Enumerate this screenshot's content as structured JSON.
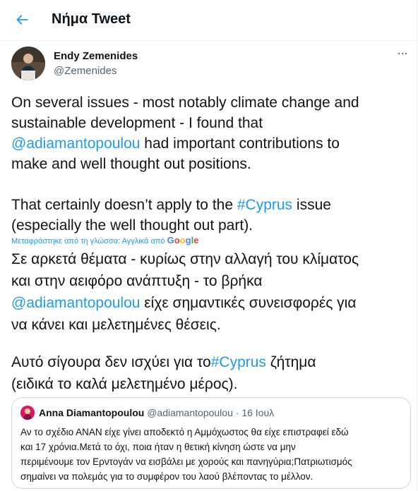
{
  "header": {
    "title": "Νήμα Tweet",
    "back_icon": "arrow-left-icon"
  },
  "tweet": {
    "author_name": "Endy Zemenides",
    "author_handle": "@Zemenides",
    "more_icon": "more-dots-icon",
    "lines": {
      "l1": "On several issues - most notably climate change and",
      "l2": "sustainable development - I found that",
      "l3_link": "@adiamantopoulou",
      "l3_rest": " had important contributions to",
      "l4": "make and well thought out positions.",
      "l5_pre": "That certainly doesn’t apply to the ",
      "l5_link": "#Cyprus",
      "l5_post": " issue",
      "l6": "(especially the well thought out part)."
    },
    "translation_note": "Μεταφράστηκε από τη γλώσσα: Αγγλικά από ",
    "translation_provider": "Google",
    "greek": {
      "g1": "Σε αρκετά θέματα - κυρίως στην αλλαγή του κλίματος",
      "g2": "και στην αειφόρο ανάπτυξη - το βρήκα",
      "g3_link": "@adiamantopoulou",
      "g3_rest": " είχε σημαντικές συνεισφορές για",
      "g4": "να κάνει και μελετημένες θέσεις.",
      "g5_pre": " Αυτό σίγουρα δεν ισχύει για το",
      "g5_link": "#Cyprus",
      "g5_post": " ζήτημα",
      "g6": "(ειδικά το καλά μελετημένο μέρος)."
    }
  },
  "quote": {
    "name": "Anna Diamantopoulou",
    "handle": "@adiamantopoulou",
    "sep": " · ",
    "date": "16 Ιουλ",
    "lines": [
      "Αν το σχέδιο ΑΝΑΝ είχε γίνει αποδεκτό η Αμμόχωστος θα  είχε επιστραφεί εδώ",
      "και 17 χρόνια.Μετά το όχι, ποια ήταν η θετική κίνηση ώστε να μην",
      "περιμένουμε τον Ερντογάν να εισβάλει με χορούς και πανηγύρια;Πατριωτισμός",
      "σημαίνει να πολεμάς για το συμφέρον του λαού βλέποντας το μέλλον."
    ]
  },
  "colors": {
    "accent": "#1d9bf0",
    "text": "#0f1419",
    "muted": "#536471",
    "border": "#cfd9de"
  }
}
